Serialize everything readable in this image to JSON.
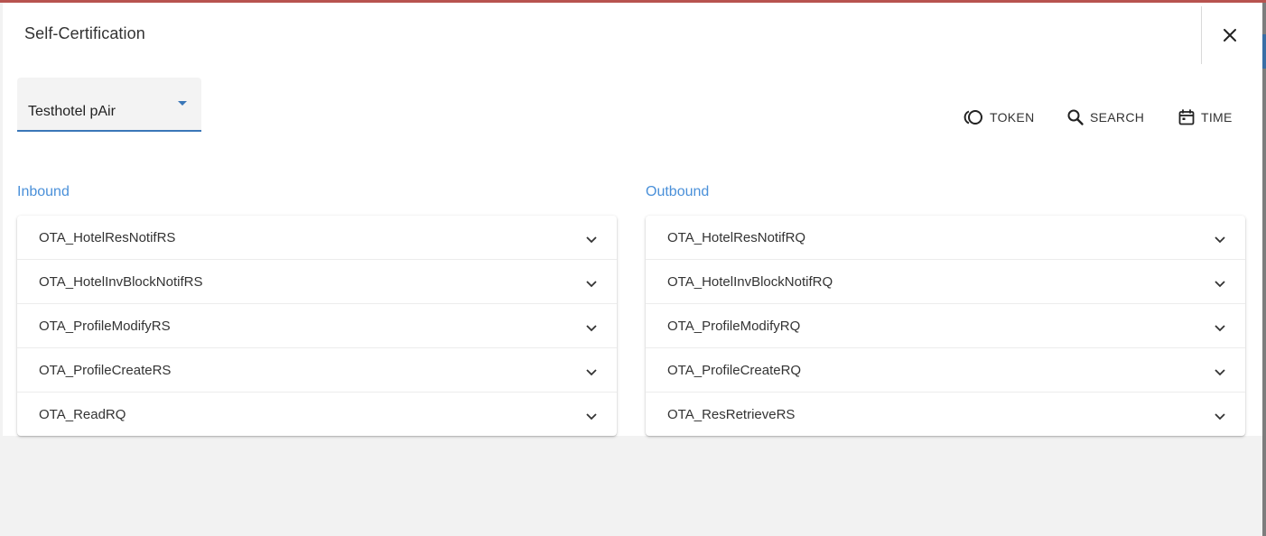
{
  "dialog": {
    "title": "Self-Certification",
    "close_icon": "close-icon"
  },
  "toolbar": {
    "hotel_select": {
      "value": "Testhotel pAir"
    },
    "buttons": [
      {
        "label": "TOKEN",
        "icon": "token-icon"
      },
      {
        "label": "SEARCH",
        "icon": "search-icon"
      },
      {
        "label": "TIME",
        "icon": "calendar-icon"
      }
    ]
  },
  "inbound": {
    "title": "Inbound",
    "items": [
      {
        "label": "OTA_HotelResNotifRS"
      },
      {
        "label": "OTA_HotelInvBlockNotifRS"
      },
      {
        "label": "OTA_ProfileModifyRS"
      },
      {
        "label": "OTA_ProfileCreateRS"
      },
      {
        "label": "OTA_ReadRQ"
      }
    ]
  },
  "outbound": {
    "title": "Outbound",
    "items": [
      {
        "label": "OTA_HotelResNotifRQ"
      },
      {
        "label": "OTA_HotelInvBlockNotifRQ"
      },
      {
        "label": "OTA_ProfileModifyRQ"
      },
      {
        "label": "OTA_ProfileCreateRQ"
      },
      {
        "label": "OTA_ResRetrieveRS"
      }
    ]
  },
  "colors": {
    "accent": "#3a77b8",
    "section_title": "#4a90d9",
    "top_bar": "#b7534f"
  }
}
